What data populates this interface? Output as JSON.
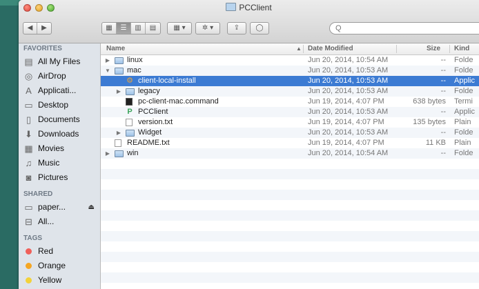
{
  "window": {
    "title": "PCClient"
  },
  "toolbar": {
    "nav": [
      "◀",
      "▶"
    ],
    "views": [
      "▦",
      "☰",
      "▥",
      "▤"
    ],
    "arrange": "▦ ▾",
    "action": "✲ ▾",
    "share": "⇪",
    "tag": "◯",
    "search_placeholder": "Q"
  },
  "sidebar": {
    "favorites_label": "FAVORITES",
    "favorites": [
      {
        "label": "All My Files",
        "icon": "▤"
      },
      {
        "label": "AirDrop",
        "icon": "◎"
      },
      {
        "label": "Applicati...",
        "icon": "A"
      },
      {
        "label": "Desktop",
        "icon": "▭"
      },
      {
        "label": "Documents",
        "icon": "▯"
      },
      {
        "label": "Downloads",
        "icon": "⬇"
      },
      {
        "label": "Movies",
        "icon": "▦"
      },
      {
        "label": "Music",
        "icon": "♫"
      },
      {
        "label": "Pictures",
        "icon": "◙"
      }
    ],
    "shared_label": "SHARED",
    "shared": [
      {
        "label": "paper...",
        "icon": "▭",
        "eject": "⏏"
      },
      {
        "label": "All...",
        "icon": "⊟"
      }
    ],
    "tags_label": "TAGS",
    "tags": [
      {
        "label": "Red",
        "color": "#f0605a"
      },
      {
        "label": "Orange",
        "color": "#f5a623"
      },
      {
        "label": "Yellow",
        "color": "#f3d23a"
      }
    ]
  },
  "columns": {
    "name": "Name",
    "sort_arrow": "▲",
    "date": "Date Modified",
    "size": "Size",
    "kind": "Kind"
  },
  "files": [
    {
      "name": "linux",
      "date": "Jun 20, 2014, 10:54 AM",
      "size": "--",
      "kind": "Folde",
      "type": "folder",
      "indent": 0,
      "disclosure": "▶"
    },
    {
      "name": "mac",
      "date": "Jun 20, 2014, 10:53 AM",
      "size": "--",
      "kind": "Folde",
      "type": "folder",
      "indent": 0,
      "disclosure": "▼"
    },
    {
      "name": "client-local-install",
      "date": "Jun 20, 2014, 10:53 AM",
      "size": "--",
      "kind": "Applic",
      "type": "app",
      "indent": 1,
      "disclosure": "",
      "selected": true
    },
    {
      "name": "legacy",
      "date": "Jun 20, 2014, 10:53 AM",
      "size": "--",
      "kind": "Folde",
      "type": "folder",
      "indent": 1,
      "disclosure": "▶"
    },
    {
      "name": "pc-client-mac.command",
      "date": "Jun 19, 2014, 4:07 PM",
      "size": "638 bytes",
      "kind": "Termi",
      "type": "term",
      "indent": 1,
      "disclosure": ""
    },
    {
      "name": "PCClient",
      "date": "Jun 20, 2014, 10:53 AM",
      "size": "--",
      "kind": "Applic",
      "type": "app2",
      "indent": 1,
      "disclosure": ""
    },
    {
      "name": "version.txt",
      "date": "Jun 19, 2014, 4:07 PM",
      "size": "135 bytes",
      "kind": "Plain",
      "type": "doc",
      "indent": 1,
      "disclosure": ""
    },
    {
      "name": "Widget",
      "date": "Jun 20, 2014, 10:53 AM",
      "size": "--",
      "kind": "Folde",
      "type": "folder",
      "indent": 1,
      "disclosure": "▶"
    },
    {
      "name": "README.txt",
      "date": "Jun 19, 2014, 4:07 PM",
      "size": "11 KB",
      "kind": "Plain",
      "type": "doc",
      "indent": 0,
      "disclosure": ""
    },
    {
      "name": "win",
      "date": "Jun 20, 2014, 10:54 AM",
      "size": "--",
      "kind": "Folde",
      "type": "folder",
      "indent": 0,
      "disclosure": "▶"
    }
  ]
}
